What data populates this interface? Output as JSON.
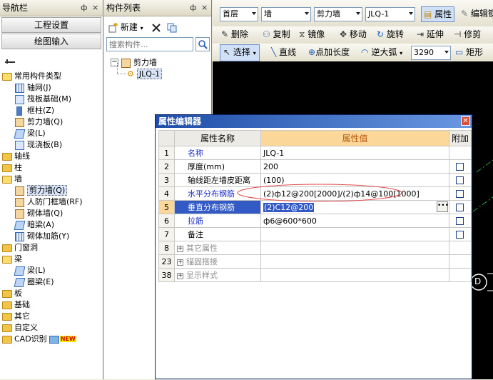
{
  "nav": {
    "title": "导航栏",
    "pin": "ф",
    "close": "×",
    "buttons": [
      "工程设置",
      "绘图输入"
    ],
    "tree": [
      {
        "label": "常用构件类型",
        "type": "folder-open",
        "level": 0
      },
      {
        "label": "轴网(J)",
        "type": "grid",
        "level": 1
      },
      {
        "label": "筏板基础(M)",
        "type": "leaf",
        "level": 1
      },
      {
        "label": "框柱(Z)",
        "type": "col",
        "level": 1
      },
      {
        "label": "剪力墙(Q)",
        "type": "wall",
        "level": 1
      },
      {
        "label": "梁(L)",
        "type": "beam",
        "level": 1
      },
      {
        "label": "现浇板(B)",
        "type": "leaf",
        "level": 1
      },
      {
        "label": "轴线",
        "type": "folder",
        "level": 0
      },
      {
        "label": "柱",
        "type": "folder",
        "level": 0
      },
      {
        "label": "墙",
        "type": "folder-open",
        "level": 0
      },
      {
        "label": "剪力墙(Q)",
        "type": "wall",
        "level": 1,
        "selected": true
      },
      {
        "label": "人防门框墙(RF)",
        "type": "wall",
        "level": 1
      },
      {
        "label": "砌体墙(Q)",
        "type": "wall",
        "level": 1
      },
      {
        "label": "暗梁(A)",
        "type": "beam",
        "level": 1
      },
      {
        "label": "砌体加筋(Y)",
        "type": "grid",
        "level": 1
      },
      {
        "label": "门窗洞",
        "type": "folder",
        "level": 0
      },
      {
        "label": "梁",
        "type": "folder-open",
        "level": 0
      },
      {
        "label": "梁(L)",
        "type": "beam",
        "level": 1
      },
      {
        "label": "圈梁(E)",
        "type": "beam",
        "level": 1
      },
      {
        "label": "板",
        "type": "folder",
        "level": 0
      },
      {
        "label": "基础",
        "type": "folder",
        "level": 0
      },
      {
        "label": "其它",
        "type": "folder",
        "level": 0
      },
      {
        "label": "自定义",
        "type": "folder",
        "level": 0
      },
      {
        "label": "CAD识别",
        "type": "folder",
        "level": 0,
        "badge": "NEW"
      }
    ]
  },
  "component_list": {
    "title": "构件列表",
    "pin": "ф",
    "close": "×",
    "new_label": "新建",
    "search_placeholder": "搜索构件...",
    "tree_root": "剪力墙",
    "tree_child": "JLQ-1"
  },
  "toolbar1": {
    "floor": "首层",
    "category": "墙",
    "type": "剪力墙",
    "component": "JLQ-1",
    "property_btn": "属性",
    "edit_btn": "编辑钢"
  },
  "toolbar2": {
    "items": [
      "删除",
      "复制",
      "镜像",
      "移动",
      "旋转",
      "延伸",
      "修剪"
    ]
  },
  "toolbar3": {
    "select": "选择",
    "line": "直线",
    "point_length": "点加长度",
    "arc": "逆大弧",
    "value": "3290",
    "rect": "矩形"
  },
  "canvas_marker": "D",
  "dialog": {
    "title": "属性编辑器",
    "headers": {
      "name": "属性名称",
      "value": "属性值",
      "extra": "附加"
    },
    "rows": [
      {
        "num": "1",
        "name": "名称",
        "value": "JLQ-1",
        "style": "blue",
        "check": false
      },
      {
        "num": "2",
        "name": "厚度(mm)",
        "value": "200",
        "style": "normal",
        "check": true
      },
      {
        "num": "3",
        "name": "轴线距左墙皮距离",
        "value": "(100)",
        "style": "normal",
        "check": true
      },
      {
        "num": "4",
        "name": "水平分布钢筋",
        "value": "(2)ф12@200[2000]/(2)ф14@100[1000]",
        "style": "blue",
        "check": true
      },
      {
        "num": "5",
        "name": "垂直分布钢筋",
        "value": "(2)C12@200",
        "style": "selected",
        "check": true
      },
      {
        "num": "6",
        "name": "拉筋",
        "value": "ф6@600*600",
        "style": "blue",
        "check": true
      },
      {
        "num": "7",
        "name": "备注",
        "value": "",
        "style": "normal",
        "check": true
      },
      {
        "num": "8",
        "name": "其它属性",
        "value": "",
        "style": "group",
        "check": false
      },
      {
        "num": "23",
        "name": "锚固搭接",
        "value": "",
        "style": "group",
        "check": false
      },
      {
        "num": "38",
        "name": "显示样式",
        "value": "",
        "style": "group",
        "check": false
      }
    ]
  },
  "colors": {
    "accent_blue": "#1b2cc9",
    "title_bar": "#1e4da8",
    "header_value": "#fbd79a",
    "canvas": "#000000",
    "grid_line": "#2ea34a"
  }
}
